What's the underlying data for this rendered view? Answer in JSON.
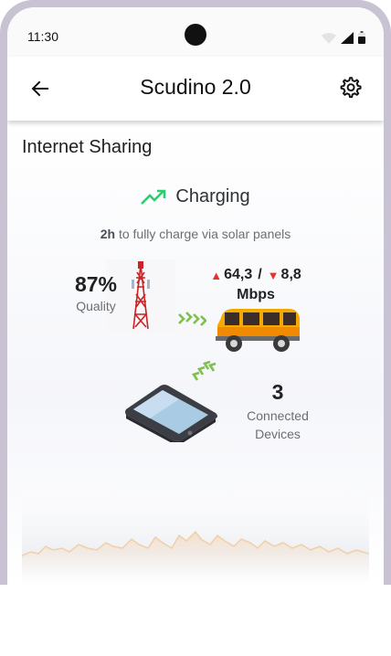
{
  "status_bar": {
    "time": "11:30",
    "icons": [
      "wifi-icon",
      "signal-icon",
      "battery-icon"
    ]
  },
  "app_bar": {
    "title": "Scudino 2.0",
    "back_icon": "arrow-left-icon",
    "settings_icon": "gear-icon"
  },
  "section": {
    "title": "Internet Sharing"
  },
  "charging": {
    "label": "Charging",
    "icon": "trending-up-icon",
    "color": "#2ecc71",
    "sub_bold": "2h",
    "sub_text": " to fully charge via solar panels"
  },
  "quality": {
    "value": "87%",
    "label": "Quality"
  },
  "speed": {
    "upload": "64,3",
    "separator": "/",
    "download": "8,8",
    "unit": "Mbps",
    "arrow_color": "#e5322b"
  },
  "devices": {
    "count": "3",
    "label_line1": "Connected",
    "label_line2": "Devices"
  }
}
